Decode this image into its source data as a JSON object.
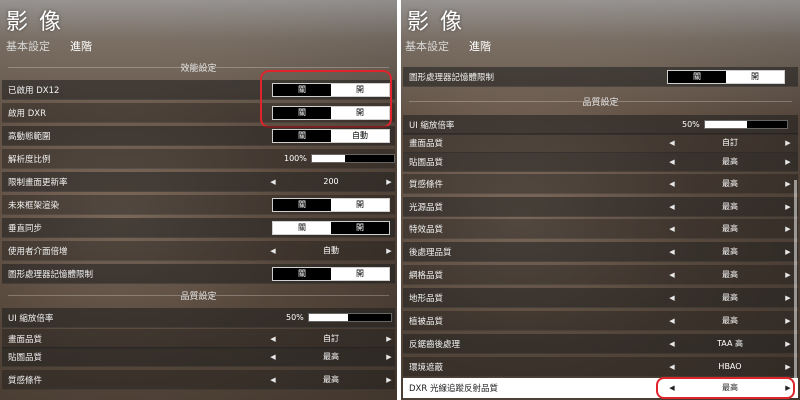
{
  "left": {
    "title": "影 像",
    "tabs": [
      "基本設定",
      "進階"
    ],
    "perf_section": "效能設定",
    "quality_section": "品質設定",
    "rows": {
      "dx12": {
        "label": "已啟用 DX12",
        "off": "關",
        "on": "開"
      },
      "dxr": {
        "label": "啟用 DXR",
        "off": "關",
        "on": "開"
      },
      "hdr": {
        "label": "高動態範圍",
        "off": "關",
        "on": "自動"
      },
      "resolution": {
        "label": "解析度比例",
        "value": "100%"
      },
      "framerate": {
        "label": "限制畫面更新率",
        "value": "200"
      },
      "future_frame": {
        "label": "未來框架渲染",
        "off": "關",
        "on": "開"
      },
      "vsync": {
        "label": "垂直同步",
        "off": "關",
        "on": "開"
      },
      "ui_scale_mult": {
        "label": "使用者介面倍增",
        "value": "自動"
      },
      "gpu_mem": {
        "label": "圖形處理器記憶體限制",
        "off": "關",
        "on": "開"
      },
      "ui_scale": {
        "label": "UI 縮放倍率",
        "value": "50%"
      },
      "quality": {
        "label": "畫面品質",
        "value": "自訂"
      },
      "texture": {
        "label": "貼圖品質",
        "value": "最高"
      },
      "material": {
        "label": "質感條件",
        "value": "最高"
      }
    },
    "sliders": {
      "resolution_pct": 0.4,
      "ui_scale_pct": 0.48
    }
  },
  "right": {
    "title": "影 像",
    "tabs": [
      "基本設定",
      "進階"
    ],
    "quality_section": "品質設定",
    "rows": {
      "gpu_mem": {
        "label": "圖形處理器記憶體限制",
        "off": "關",
        "on": "開"
      },
      "ui_scale": {
        "label": "UI 縮放倍率",
        "value": "50%"
      },
      "quality": {
        "label": "畫面品質",
        "value": "自訂"
      },
      "texture": {
        "label": "貼圖品質",
        "value": "最高"
      },
      "material": {
        "label": "質感條件",
        "value": "最高"
      },
      "light": {
        "label": "光源品質",
        "value": "最高"
      },
      "effects": {
        "label": "特效品質",
        "value": "最高"
      },
      "postproc": {
        "label": "後處理品質",
        "value": "最高"
      },
      "mesh": {
        "label": "網格品質",
        "value": "最高"
      },
      "terrain": {
        "label": "地形品質",
        "value": "最高"
      },
      "vegetation": {
        "label": "植被品質",
        "value": "最高"
      },
      "aa": {
        "label": "反鋸齒後處理",
        "value": "TAA 高"
      },
      "ao": {
        "label": "環境遮蔽",
        "value": "HBAO"
      },
      "dxr_reflect": {
        "label": "DXR 光線追蹤反射品質",
        "value": "最高"
      }
    },
    "sliders": {
      "ui_scale_pct": 0.52
    }
  },
  "arrows": {
    "left": "◀",
    "right": "▶"
  }
}
